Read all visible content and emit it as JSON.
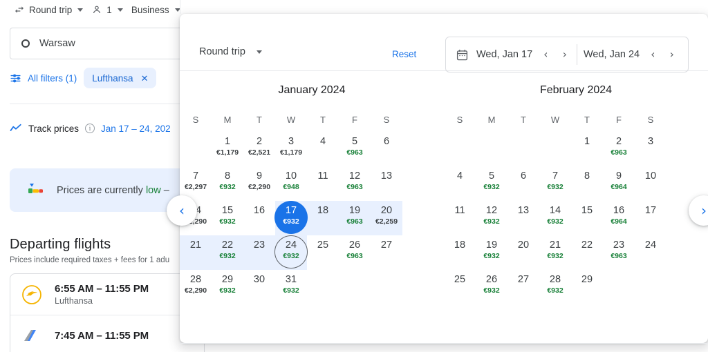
{
  "toolbar": {
    "trip_type": "Round trip",
    "trip_icon": "swap-horizontal-icon",
    "passengers": "1",
    "passengers_icon": "person-icon",
    "cabin_class": "Business"
  },
  "search": {
    "origin_value": "Warsaw",
    "origin_icon": "circle-origin-icon"
  },
  "filters": {
    "all_filters_label": "All filters (1)",
    "all_filters_icon": "tune-icon",
    "chips": [
      {
        "label": "Lufthansa",
        "remove_icon": "close-icon"
      }
    ]
  },
  "track_prices": {
    "label": "Track prices",
    "icon": "trending-chart-icon",
    "info_icon": "info-icon",
    "info_glyph": "i",
    "dates": "Jan 17 – 24, 202"
  },
  "price_banner": {
    "icon": "price-gauge-icon",
    "text_before": "Prices are currently ",
    "highlight": "low",
    "text_after": " –"
  },
  "departing": {
    "title": "Departing flights",
    "subtitle": "Prices include required taxes + fees for 1 adu",
    "flights": [
      {
        "times": "6:55 AM – 11:55 PM",
        "airline": "Lufthansa",
        "logo": "lufthansa-logo-icon"
      },
      {
        "times": "7:45 AM – 11:55 PM",
        "airline": "",
        "logo": "airline-tail-icon"
      }
    ]
  },
  "calendar_popup": {
    "trip_type": "Round trip",
    "trip_caret_icon": "chevron-down-icon",
    "reset_label": "Reset",
    "calendar_icon": "calendar-icon",
    "departure_date": "Wed, Jan 17",
    "return_date": "Wed, Jan 24",
    "prev_icon": "chevron-left-icon",
    "next_icon": "chevron-right-icon",
    "page_prev_icon": "chevron-left-icon",
    "page_next_icon": "chevron-right-icon",
    "dow": [
      "S",
      "M",
      "T",
      "W",
      "T",
      "F",
      "S"
    ],
    "selected_start": {
      "month": 0,
      "day": 17
    },
    "selected_end": {
      "month": 0,
      "day": 24
    },
    "colors": {
      "accent": "#1a73e8",
      "range_fill": "#e8f0fe",
      "cheap_price": "#188038",
      "normal_price": "#3c4043"
    },
    "months": [
      {
        "title": "January 2024",
        "lead_blank": 1,
        "days": [
          {
            "d": 1,
            "price": "€1,179",
            "cheap": false
          },
          {
            "d": 2,
            "price": "€2,521",
            "cheap": false
          },
          {
            "d": 3,
            "price": "€1,179",
            "cheap": false
          },
          {
            "d": 4,
            "price": "",
            "cheap": false
          },
          {
            "d": 5,
            "price": "€963",
            "cheap": true
          },
          {
            "d": 6,
            "price": "",
            "cheap": false
          },
          {
            "d": 7,
            "price": "€2,297",
            "cheap": false
          },
          {
            "d": 8,
            "price": "€932",
            "cheap": true
          },
          {
            "d": 9,
            "price": "€2,290",
            "cheap": false
          },
          {
            "d": 10,
            "price": "€948",
            "cheap": true
          },
          {
            "d": 11,
            "price": "",
            "cheap": false
          },
          {
            "d": 12,
            "price": "€963",
            "cheap": true
          },
          {
            "d": 13,
            "price": "",
            "cheap": false
          },
          {
            "d": 14,
            "price": "€2,290",
            "cheap": false
          },
          {
            "d": 15,
            "price": "€932",
            "cheap": true
          },
          {
            "d": 16,
            "price": "",
            "cheap": false
          },
          {
            "d": 17,
            "price": "€932",
            "cheap": true
          },
          {
            "d": 18,
            "price": "",
            "cheap": false
          },
          {
            "d": 19,
            "price": "€963",
            "cheap": true
          },
          {
            "d": 20,
            "price": "€2,259",
            "cheap": false
          },
          {
            "d": 21,
            "price": "",
            "cheap": false
          },
          {
            "d": 22,
            "price": "€932",
            "cheap": true
          },
          {
            "d": 23,
            "price": "",
            "cheap": false
          },
          {
            "d": 24,
            "price": "€932",
            "cheap": true
          },
          {
            "d": 25,
            "price": "",
            "cheap": false
          },
          {
            "d": 26,
            "price": "€963",
            "cheap": true
          },
          {
            "d": 27,
            "price": "",
            "cheap": false
          },
          {
            "d": 28,
            "price": "€2,290",
            "cheap": false
          },
          {
            "d": 29,
            "price": "€932",
            "cheap": true
          },
          {
            "d": 30,
            "price": "",
            "cheap": false
          },
          {
            "d": 31,
            "price": "€932",
            "cheap": true
          }
        ]
      },
      {
        "title": "February 2024",
        "lead_blank": 4,
        "days": [
          {
            "d": 1,
            "price": "",
            "cheap": false
          },
          {
            "d": 2,
            "price": "€963",
            "cheap": true
          },
          {
            "d": 3,
            "price": "",
            "cheap": false
          },
          {
            "d": 4,
            "price": "",
            "cheap": false
          },
          {
            "d": 5,
            "price": "€932",
            "cheap": true
          },
          {
            "d": 6,
            "price": "",
            "cheap": false
          },
          {
            "d": 7,
            "price": "€932",
            "cheap": true
          },
          {
            "d": 8,
            "price": "",
            "cheap": false
          },
          {
            "d": 9,
            "price": "€964",
            "cheap": true
          },
          {
            "d": 10,
            "price": "",
            "cheap": false
          },
          {
            "d": 11,
            "price": "",
            "cheap": false
          },
          {
            "d": 12,
            "price": "€932",
            "cheap": true
          },
          {
            "d": 13,
            "price": "",
            "cheap": false
          },
          {
            "d": 14,
            "price": "€932",
            "cheap": true
          },
          {
            "d": 15,
            "price": "",
            "cheap": false
          },
          {
            "d": 16,
            "price": "€964",
            "cheap": true
          },
          {
            "d": 17,
            "price": "",
            "cheap": false
          },
          {
            "d": 18,
            "price": "",
            "cheap": false
          },
          {
            "d": 19,
            "price": "€932",
            "cheap": true
          },
          {
            "d": 20,
            "price": "",
            "cheap": false
          },
          {
            "d": 21,
            "price": "€932",
            "cheap": true
          },
          {
            "d": 22,
            "price": "",
            "cheap": false
          },
          {
            "d": 23,
            "price": "€963",
            "cheap": true
          },
          {
            "d": 24,
            "price": "",
            "cheap": false
          },
          {
            "d": 25,
            "price": "",
            "cheap": false
          },
          {
            "d": 26,
            "price": "€932",
            "cheap": true
          },
          {
            "d": 27,
            "price": "",
            "cheap": false
          },
          {
            "d": 28,
            "price": "€932",
            "cheap": true
          },
          {
            "d": 29,
            "price": "",
            "cheap": false
          }
        ]
      }
    ]
  }
}
